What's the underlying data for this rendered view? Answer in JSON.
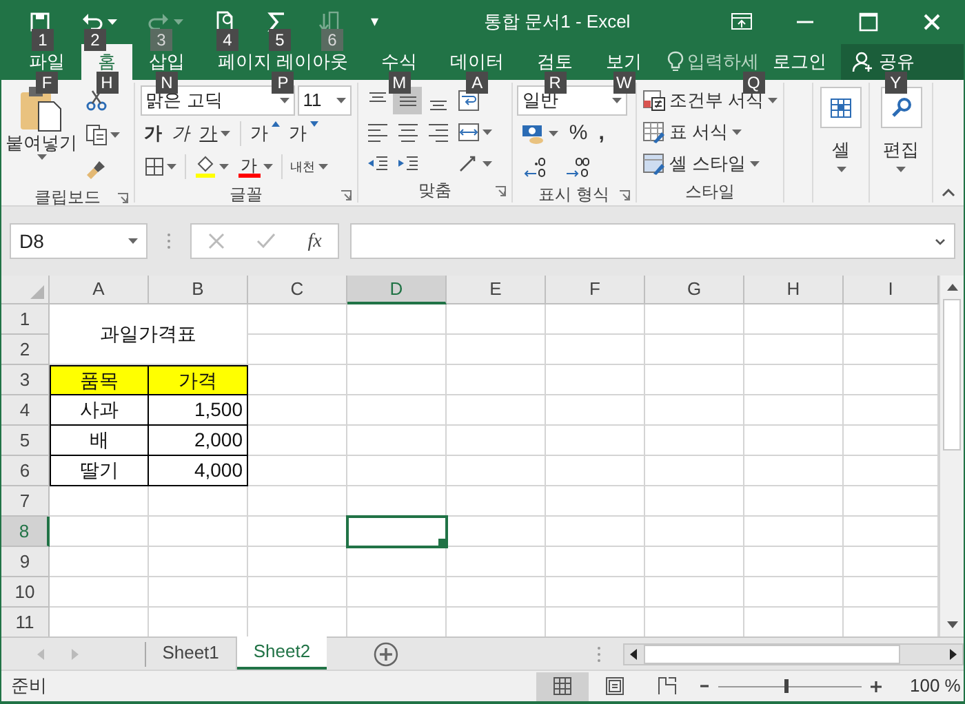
{
  "window": {
    "title": "통합 문서1 - Excel",
    "customize_caret": "▾"
  },
  "quick_access": [
    {
      "kind": "save",
      "keytip": "1",
      "disabled": false
    },
    {
      "kind": "undo",
      "keytip": "2",
      "disabled": false
    },
    {
      "kind": "redo",
      "keytip": "3",
      "disabled": true
    },
    {
      "kind": "new",
      "keytip": "4",
      "disabled": false
    },
    {
      "kind": "sum",
      "keytip": "5",
      "disabled": false
    },
    {
      "kind": "sort",
      "keytip": "6",
      "disabled": true
    }
  ],
  "tabs": [
    {
      "label": "파일",
      "keytip": "F",
      "selected": false
    },
    {
      "label": "홈",
      "keytip": "H",
      "selected": true
    },
    {
      "label": "삽입",
      "keytip": "N",
      "selected": false
    },
    {
      "label": "페이지 레이아웃",
      "keytip": "P",
      "selected": false
    },
    {
      "label": "수식",
      "keytip": "M",
      "selected": false
    },
    {
      "label": "데이터",
      "keytip": "A",
      "selected": false
    },
    {
      "label": "검토",
      "keytip": "R",
      "selected": false
    },
    {
      "label": "보기",
      "keytip": "W",
      "selected": false
    }
  ],
  "tell_me": {
    "placeholder": "입력하세",
    "keytip": "Q"
  },
  "sign_in": "로그인",
  "share": {
    "label": "공유",
    "keytip": "Y"
  },
  "ribbon": {
    "clipboard": {
      "label": "클립보드",
      "paste": "붙여넣기"
    },
    "font": {
      "label": "글꼴",
      "name": "맑은 고딕",
      "size": "11",
      "bold": "가",
      "italic": "가",
      "underline": "가",
      "grow": "가",
      "shrink": "가",
      "font_color_label": "가",
      "phonetic": "내천"
    },
    "alignment": {
      "label": "맞춤",
      "buttons": [
        {
          "kind": "top",
          "selected": false
        },
        {
          "kind": "middle",
          "selected": true
        },
        {
          "kind": "bottom",
          "selected": false
        },
        {
          "kind": "left",
          "selected": false
        },
        {
          "kind": "center",
          "selected": false
        },
        {
          "kind": "right",
          "selected": false
        }
      ]
    },
    "number": {
      "label": "표시 형식",
      "format": "일반",
      "percent": "%",
      "comma": ","
    },
    "styles": {
      "label": "스타일",
      "items": [
        "조건부 서식",
        "표 서식",
        "셀 스타일"
      ]
    },
    "cells": {
      "label": "셀"
    },
    "editing": {
      "label": "편집"
    }
  },
  "formula_bar": {
    "name_box": "D8",
    "function_label": "fx"
  },
  "grid": {
    "columns": [
      {
        "label": "A",
        "selected": false
      },
      {
        "label": "B",
        "selected": false
      },
      {
        "label": "C",
        "selected": false
      },
      {
        "label": "D",
        "selected": true
      },
      {
        "label": "E",
        "selected": false
      },
      {
        "label": "F",
        "selected": false
      },
      {
        "label": "G",
        "selected": false
      },
      {
        "label": "H",
        "selected": false
      },
      {
        "label": "I",
        "selected": false
      }
    ],
    "rows": [
      {
        "label": "1",
        "selected": false
      },
      {
        "label": "2",
        "selected": false
      },
      {
        "label": "3",
        "selected": false
      },
      {
        "label": "4",
        "selected": false
      },
      {
        "label": "5",
        "selected": false
      },
      {
        "label": "6",
        "selected": false
      },
      {
        "label": "7",
        "selected": false
      },
      {
        "label": "8",
        "selected": true
      },
      {
        "label": "9",
        "selected": false
      },
      {
        "label": "10",
        "selected": false
      },
      {
        "label": "11",
        "selected": false
      }
    ],
    "title": "과일가격표",
    "table": {
      "columns": [
        "품목",
        "가격"
      ],
      "rows": [
        [
          "사과",
          "1,500"
        ],
        [
          "배",
          "2,000"
        ],
        [
          "딸기",
          "4,000"
        ]
      ]
    }
  },
  "sheets": [
    {
      "label": "Sheet1",
      "selected": false
    },
    {
      "label": "Sheet2",
      "selected": true
    }
  ],
  "status_bar": {
    "status": "준비",
    "views": [
      {
        "kind": "normal",
        "selected": true
      },
      {
        "kind": "page-layout",
        "selected": false
      },
      {
        "kind": "page-break",
        "selected": false
      }
    ],
    "zoom": {
      "level": 0.47,
      "reading": "100 %"
    }
  }
}
